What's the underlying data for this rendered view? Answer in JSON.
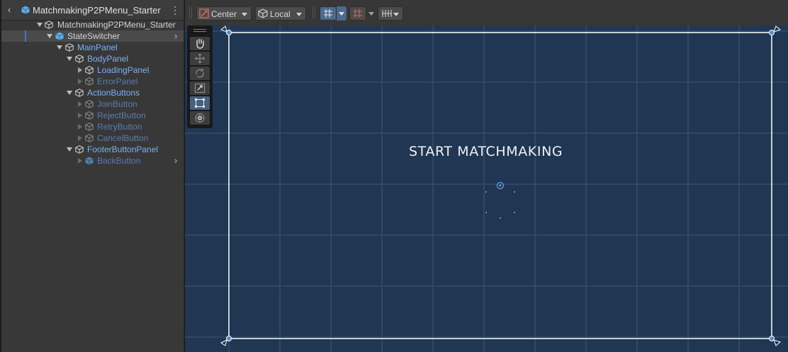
{
  "hierarchy": {
    "title": "MatchmakingP2PMenu_Starter",
    "items": [
      {
        "label": "MatchmakingP2PMenu_Starter"
      },
      {
        "label": "StateSwitcher"
      },
      {
        "label": "MainPanel"
      },
      {
        "label": "BodyPanel"
      },
      {
        "label": "LoadingPanel"
      },
      {
        "label": "ErrorPanel"
      },
      {
        "label": "ActionButtons"
      },
      {
        "label": "JoinButton"
      },
      {
        "label": "RejectButton"
      },
      {
        "label": "RetryButton"
      },
      {
        "label": "CancelButton"
      },
      {
        "label": "FooterButtonPanel"
      },
      {
        "label": "BackButton"
      }
    ]
  },
  "toolbar": {
    "pivot_label": "Center",
    "space_label": "Local"
  },
  "canvas": {
    "text": "START MATCHMAKING"
  }
}
